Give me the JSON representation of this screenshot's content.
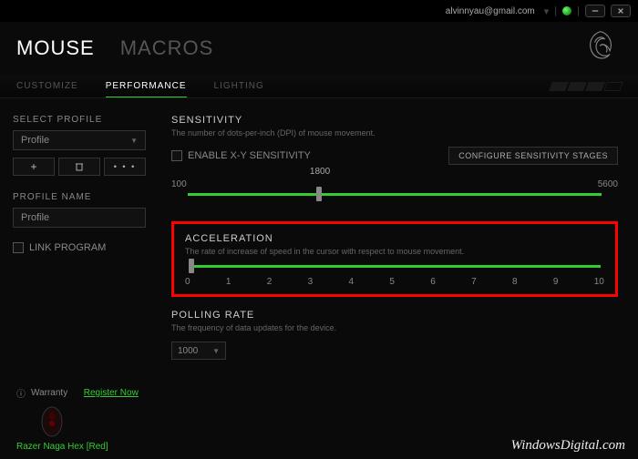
{
  "topbar": {
    "email": "alvinnyau@gmail.com"
  },
  "nav": {
    "tabs": [
      "MOUSE",
      "MACROS"
    ],
    "active": 0,
    "subtabs": [
      "CUSTOMIZE",
      "PERFORMANCE",
      "LIGHTING"
    ],
    "subactive": 1
  },
  "sidebar": {
    "select_profile_label": "SELECT PROFILE",
    "profile_value": "Profile",
    "btn_add": "+",
    "btn_del": "🗑",
    "btn_more": "• • •",
    "profile_name_label": "PROFILE NAME",
    "profile_name_value": "Profile",
    "link_program_label": "LINK PROGRAM"
  },
  "sensitivity": {
    "title": "SENSITIVITY",
    "desc": "The number of dots-per-inch (DPI) of mouse movement.",
    "enable_xy_label": "ENABLE X-Y SENSITIVITY",
    "configure_btn": "CONFIGURE SENSITIVITY STAGES",
    "min": "100",
    "max": "5600",
    "value": "1800",
    "handle_pct": 31
  },
  "acceleration": {
    "title": "ACCELERATION",
    "desc": "The rate of increase of speed in the cursor with respect to mouse movement.",
    "ticks": [
      "0",
      "1",
      "2",
      "3",
      "4",
      "5",
      "6",
      "7",
      "8",
      "9",
      "10"
    ],
    "handle_pct": 0
  },
  "polling": {
    "title": "POLLING RATE",
    "desc": "The frequency of data updates for the device.",
    "value": "1000"
  },
  "footer": {
    "warranty_label": "Warranty",
    "register_label": "Register Now",
    "device_name": "Razer Naga Hex [Red]"
  },
  "watermark": "WindowsDigital.com"
}
